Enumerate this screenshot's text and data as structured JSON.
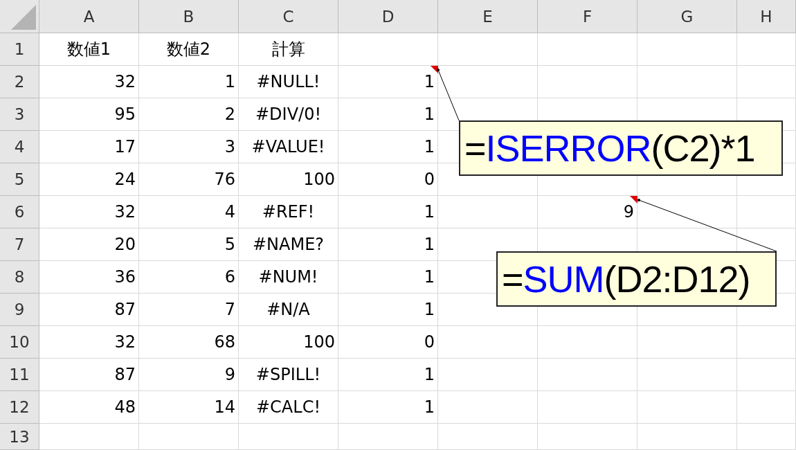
{
  "columns": [
    "A",
    "B",
    "C",
    "D",
    "E",
    "F",
    "G",
    "H"
  ],
  "rows": [
    {
      "header": "1",
      "cells": [
        {
          "text": "数値1",
          "kind": "label"
        },
        {
          "text": "数値2",
          "kind": "label"
        },
        {
          "text": "計算",
          "kind": "label"
        }
      ]
    },
    {
      "header": "2",
      "cells": [
        {
          "text": "32",
          "kind": "number"
        },
        {
          "text": "1",
          "kind": "number"
        },
        {
          "text": "#NULL!",
          "kind": "error"
        },
        {
          "text": "1",
          "kind": "number",
          "comment": true
        }
      ]
    },
    {
      "header": "3",
      "cells": [
        {
          "text": "95",
          "kind": "number"
        },
        {
          "text": "2",
          "kind": "number"
        },
        {
          "text": "#DIV/0!",
          "kind": "error"
        },
        {
          "text": "1",
          "kind": "number"
        }
      ]
    },
    {
      "header": "4",
      "cells": [
        {
          "text": "17",
          "kind": "number"
        },
        {
          "text": "3",
          "kind": "number"
        },
        {
          "text": "#VALUE!",
          "kind": "error"
        },
        {
          "text": "1",
          "kind": "number"
        }
      ]
    },
    {
      "header": "5",
      "cells": [
        {
          "text": "24",
          "kind": "number"
        },
        {
          "text": "76",
          "kind": "number"
        },
        {
          "text": "100",
          "kind": "number"
        },
        {
          "text": "0",
          "kind": "number"
        }
      ]
    },
    {
      "header": "6",
      "cells": [
        {
          "text": "32",
          "kind": "number"
        },
        {
          "text": "4",
          "kind": "number"
        },
        {
          "text": "#REF!",
          "kind": "error"
        },
        {
          "text": "1",
          "kind": "number"
        },
        null,
        {
          "text": "9",
          "kind": "number",
          "comment": true
        }
      ]
    },
    {
      "header": "7",
      "cells": [
        {
          "text": "20",
          "kind": "number"
        },
        {
          "text": "5",
          "kind": "number"
        },
        {
          "text": "#NAME?",
          "kind": "error"
        },
        {
          "text": "1",
          "kind": "number"
        }
      ]
    },
    {
      "header": "8",
      "cells": [
        {
          "text": "36",
          "kind": "number"
        },
        {
          "text": "6",
          "kind": "number"
        },
        {
          "text": "#NUM!",
          "kind": "error"
        },
        {
          "text": "1",
          "kind": "number"
        }
      ]
    },
    {
      "header": "9",
      "cells": [
        {
          "text": "87",
          "kind": "number"
        },
        {
          "text": "7",
          "kind": "number"
        },
        {
          "text": "#N/A",
          "kind": "error"
        },
        {
          "text": "1",
          "kind": "number"
        }
      ]
    },
    {
      "header": "10",
      "cells": [
        {
          "text": "32",
          "kind": "number"
        },
        {
          "text": "68",
          "kind": "number"
        },
        {
          "text": "100",
          "kind": "number"
        },
        {
          "text": "0",
          "kind": "number"
        }
      ]
    },
    {
      "header": "11",
      "cells": [
        {
          "text": "87",
          "kind": "number"
        },
        {
          "text": "9",
          "kind": "number"
        },
        {
          "text": "#SPILL!",
          "kind": "error"
        },
        {
          "text": "1",
          "kind": "number"
        }
      ]
    },
    {
      "header": "12",
      "cells": [
        {
          "text": "48",
          "kind": "number"
        },
        {
          "text": "14",
          "kind": "number"
        },
        {
          "text": "#CALC!",
          "kind": "error"
        },
        {
          "text": "1",
          "kind": "number"
        }
      ]
    },
    {
      "header": "13"
    }
  ],
  "callouts": [
    {
      "prefix": "=",
      "function": "ISERROR",
      "args": "(C2)*1"
    },
    {
      "prefix": "=",
      "function": "SUM",
      "args": "(D2:D12)"
    }
  ]
}
